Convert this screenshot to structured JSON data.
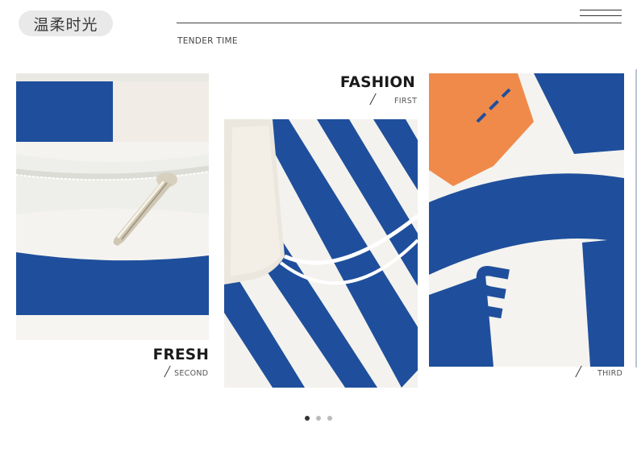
{
  "header": {
    "title": "温柔时光",
    "subtitle": "TENDER TIME",
    "menu_icon": "menu-icon"
  },
  "cards": [
    {
      "heading": "FRESH",
      "label": "SECOND"
    },
    {
      "heading": "FASHION",
      "label": "FIRST"
    },
    {
      "heading": "",
      "label": "THIRD"
    }
  ],
  "colors": {
    "blue": "#1f4f9c",
    "white": "#f5f5f2",
    "orange": "#f08a4b"
  },
  "pagination": {
    "count": 3,
    "active": 1
  }
}
